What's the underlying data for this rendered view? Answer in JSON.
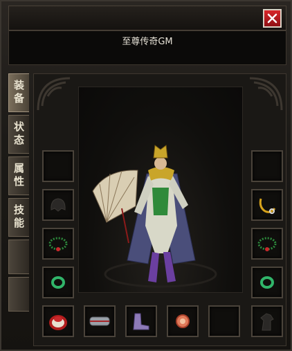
{
  "window": {
    "character_name": "至尊传奇GM"
  },
  "tabs": [
    {
      "label": "装备",
      "active": true
    },
    {
      "label": "状态",
      "active": false
    },
    {
      "label": "属性",
      "active": false
    },
    {
      "label": "技能",
      "active": false
    }
  ],
  "slots": {
    "left": [
      "empty",
      "helmet-outline",
      "necklace-beads",
      "bracelet-jade"
    ],
    "right": [
      "empty",
      "necklace-gold",
      "necklace-beads",
      "bracelet-jade"
    ],
    "bottom": [
      "ring-red",
      "belt",
      "boots",
      "gem-red",
      "empty",
      "horse-outline"
    ]
  },
  "colors": {
    "close_bg": "#c81c20",
    "tab_active": "#7a6e5b",
    "slot_border": "#4a433a"
  }
}
